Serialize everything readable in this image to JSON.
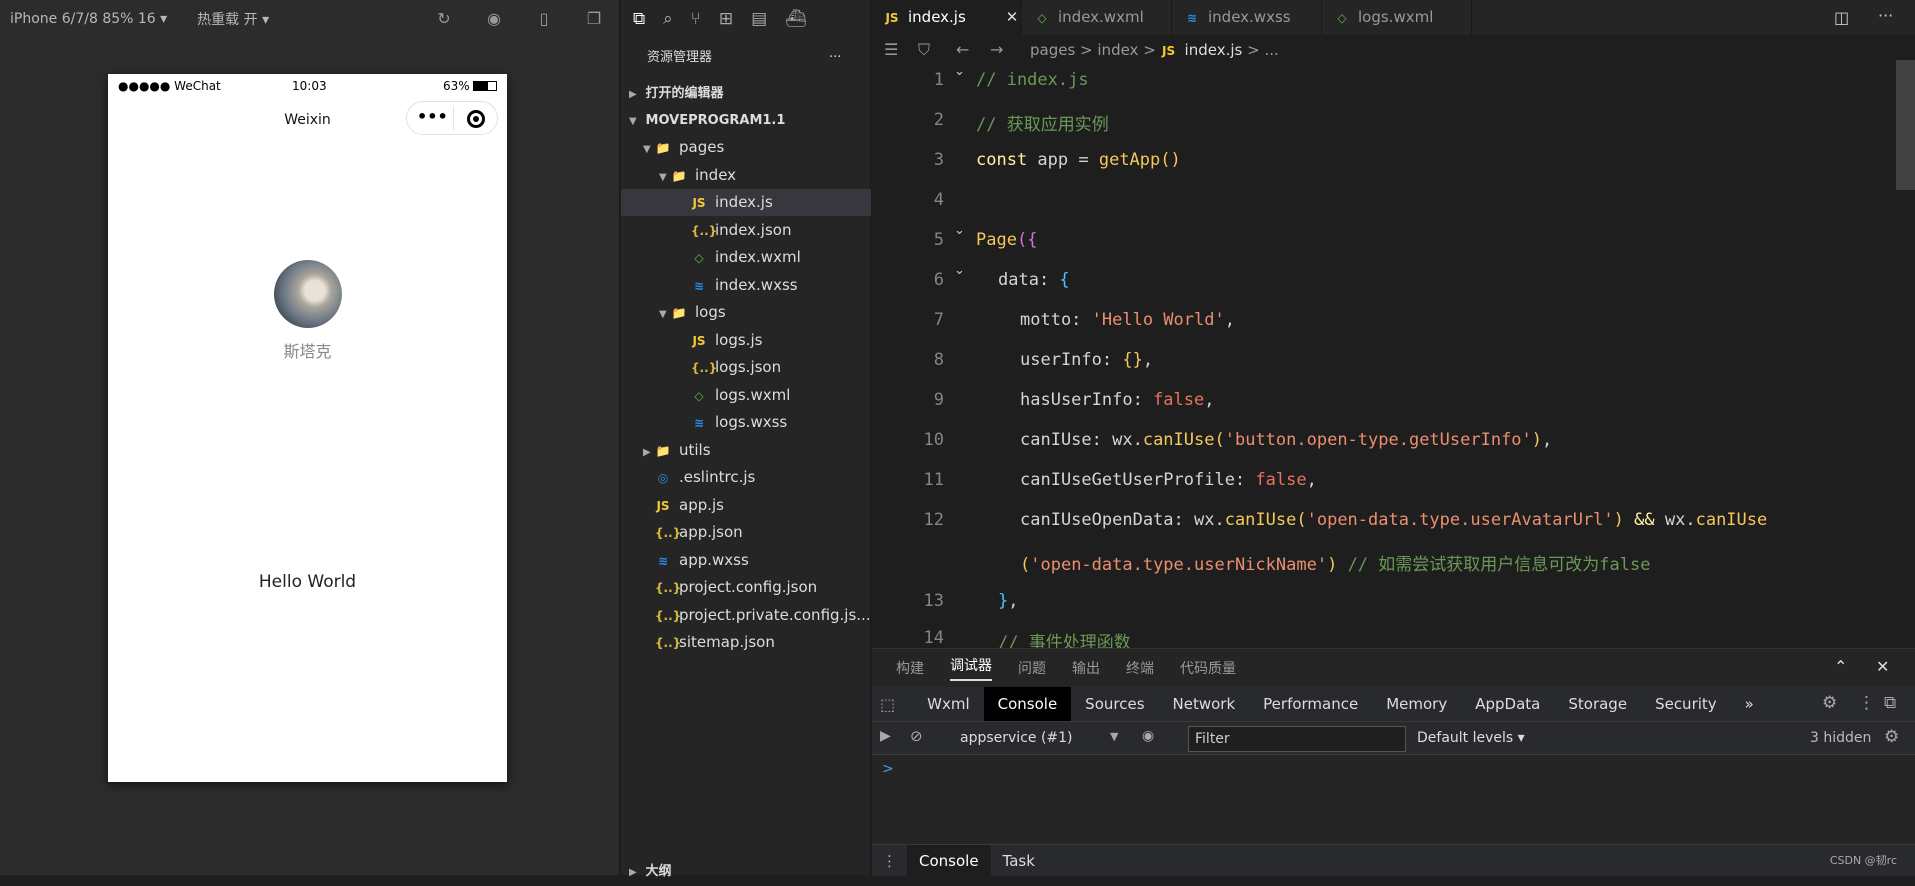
{
  "simulator": {
    "device": "iPhone 6/7/8 85% 16 ▾",
    "hot_reload": "热重载 开 ▾",
    "status": {
      "signal": "●●●●● WeChat",
      "time": "10:03",
      "battery": "63%"
    },
    "nav_title": "Weixin",
    "capsule_more": "•••",
    "nickname": "斯塔克",
    "motto": "Hello World"
  },
  "explorer": {
    "title": "资源管理器",
    "more": "···",
    "open_editors": "打开的编辑器",
    "project": "MOVEPROGRAM1.1",
    "outline": "大纲",
    "items": [
      {
        "label": "pages",
        "type": "folder"
      },
      {
        "label": "index",
        "type": "folder"
      },
      {
        "label": "index.js",
        "type": "js"
      },
      {
        "label": "index.json",
        "type": "json"
      },
      {
        "label": "index.wxml",
        "type": "wxml"
      },
      {
        "label": "index.wxss",
        "type": "wxss"
      },
      {
        "label": "logs",
        "type": "folder"
      },
      {
        "label": "logs.js",
        "type": "js"
      },
      {
        "label": "logs.json",
        "type": "json"
      },
      {
        "label": "logs.wxml",
        "type": "wxml"
      },
      {
        "label": "logs.wxss",
        "type": "wxss"
      },
      {
        "label": "utils",
        "type": "folder"
      },
      {
        "label": ".eslintrc.js",
        "type": "eslint"
      },
      {
        "label": "app.js",
        "type": "js"
      },
      {
        "label": "app.json",
        "type": "json"
      },
      {
        "label": "app.wxss",
        "type": "wxss"
      },
      {
        "label": "project.config.json",
        "type": "json"
      },
      {
        "label": "project.private.config.js...",
        "type": "json"
      },
      {
        "label": "sitemap.json",
        "type": "json"
      }
    ]
  },
  "editor": {
    "tabs": [
      "index.js",
      "index.wxml",
      "index.wxss",
      "logs.wxml"
    ],
    "breadcrumb": [
      "pages",
      "index",
      "index.js",
      "..."
    ],
    "line_numbers": [
      "1",
      "2",
      "3",
      "4",
      "5",
      "6",
      "7",
      "8",
      "9",
      "10",
      "11",
      "12",
      "",
      "13",
      "14"
    ]
  },
  "panel": {
    "tabs": [
      "构建",
      "调试器",
      "问题",
      "输出",
      "终端",
      "代码质量"
    ],
    "devtools_tabs": [
      "Wxml",
      "Console",
      "Sources",
      "Network",
      "Performance",
      "Memory",
      "AppData",
      "Storage",
      "Security"
    ],
    "context": "appservice (#1)",
    "filter_placeholder": "Filter",
    "levels": "Default levels ▾",
    "hidden": "3 hidden",
    "prompt": ">",
    "bottom_tabs": [
      "Console",
      "Task"
    ],
    "watermark": "CSDN @韧rc"
  }
}
